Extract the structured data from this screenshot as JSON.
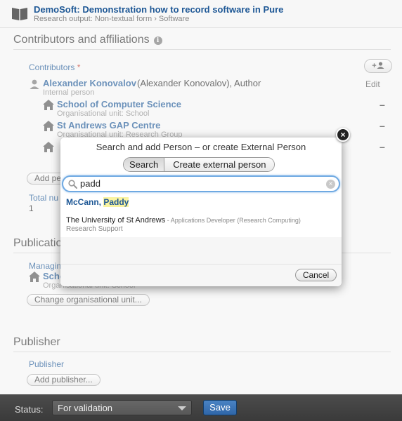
{
  "header": {
    "title": "DemoSoft: Demonstration how to record software in Pure",
    "breadcrumb": "Research output: Non-textual form › Software"
  },
  "contributors_section": {
    "title": "Contributors and affiliations",
    "contributors_label": "Contributors",
    "required_mark": "*",
    "add_button_label": "+",
    "edit_label": "Edit",
    "person_name": "Alexander Konovalov",
    "person_detail": "(Alexander Konovalov), Author",
    "person_type": "Internal person",
    "units": [
      {
        "name": "School of Computer Science",
        "type": "Organisational unit: School"
      },
      {
        "name": "St Andrews GAP Centre",
        "type": "Organisational unit: Research Group"
      },
      {
        "name": "",
        "type": ""
      }
    ],
    "add_person_label": "Add pe",
    "total_label": "Total nu",
    "total_value": "1",
    "remove_label": "–"
  },
  "publication_section": {
    "title": "Publicatio",
    "managing_label": "Managin",
    "unit_name": "Scho",
    "unit_type": "Organisational unit: School",
    "change_button": "Change organisational unit..."
  },
  "publisher_section": {
    "title": "Publisher",
    "label": "Publisher",
    "add_button": "Add publisher..."
  },
  "dialog": {
    "title": "Search and add Person – or create External Person",
    "tab_search": "Search",
    "tab_create": "Create external person",
    "search_value": "padd",
    "result1_prefix": "McCann, ",
    "result1_highlight": "Paddy",
    "result2_org": "The University of St Andrews",
    "result2_role": " - Applications Developer (Research Computing)",
    "result2_sub": "Research Support",
    "cancel_label": "Cancel",
    "close_glyph": "×"
  },
  "footer": {
    "status_label": "Status:",
    "status_value": "For validation",
    "save_label": "Save"
  }
}
